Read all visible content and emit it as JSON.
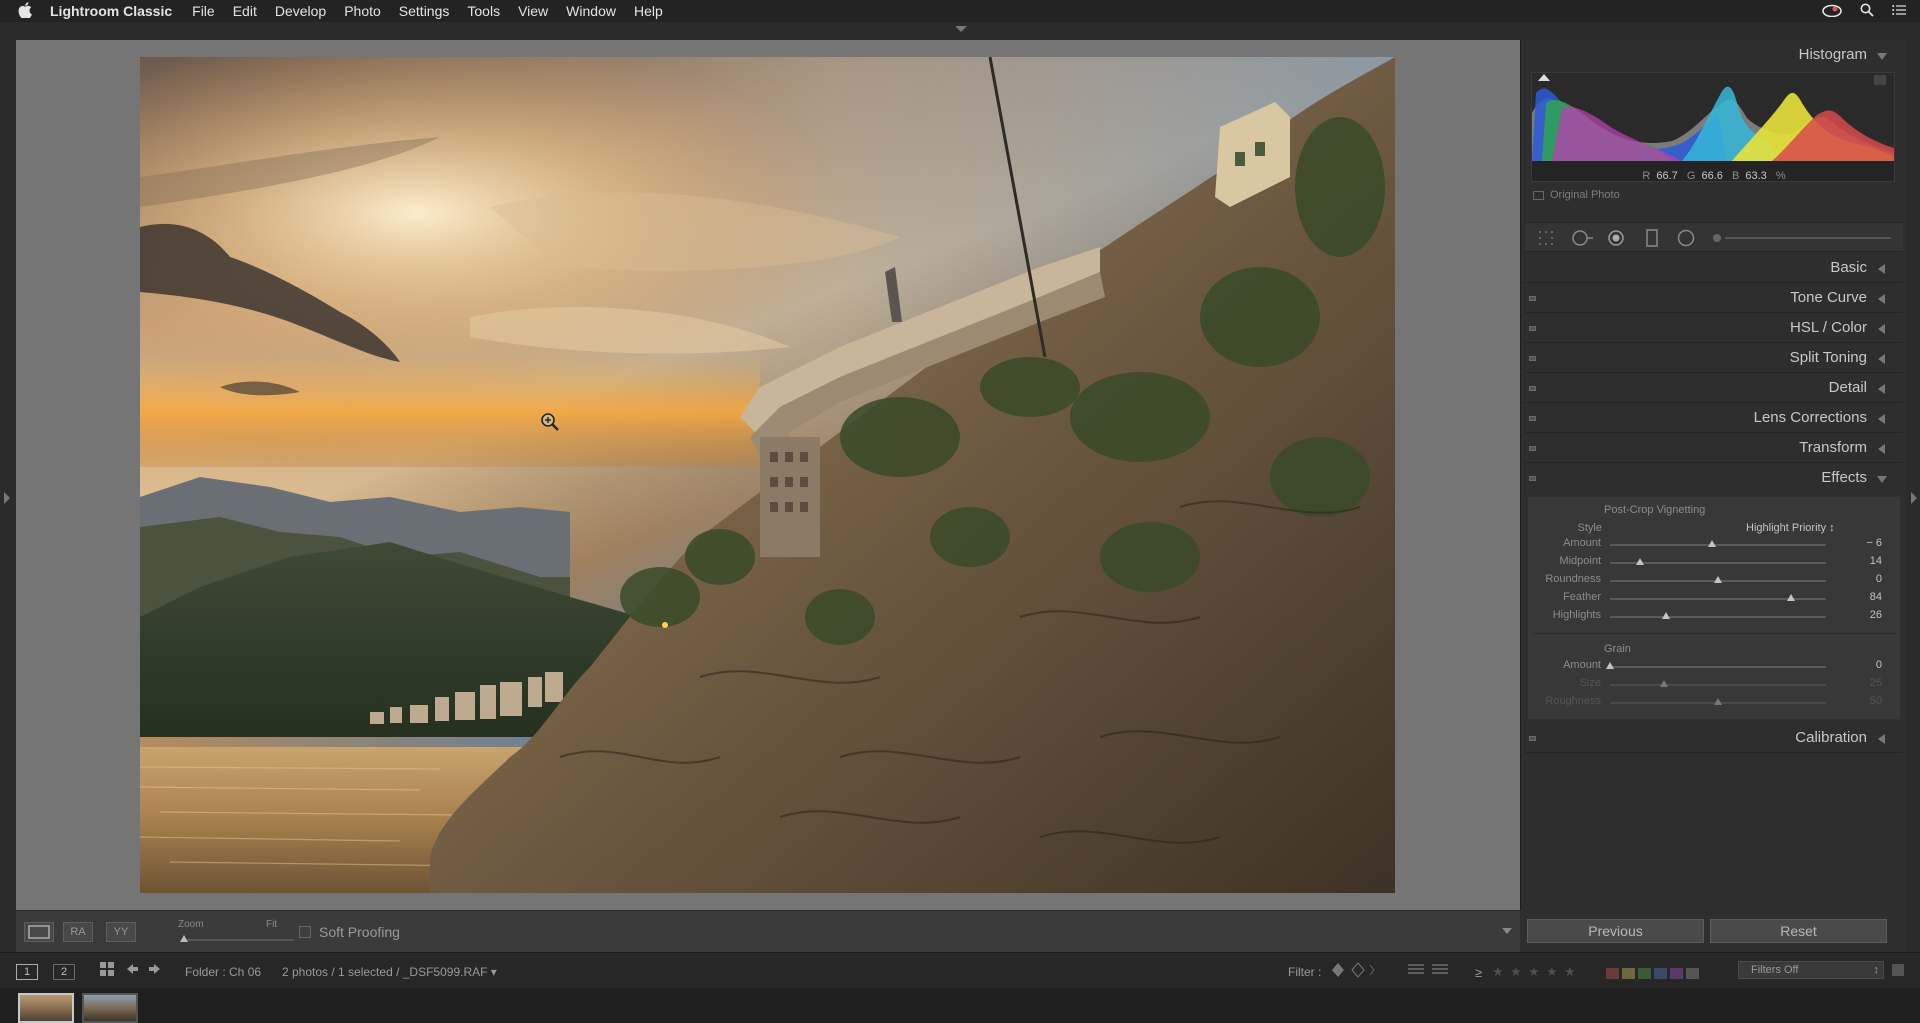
{
  "menubar": {
    "apple": "",
    "app_name": "Lightroom Classic",
    "menus": [
      "File",
      "Edit",
      "Develop",
      "Photo",
      "Settings",
      "Tools",
      "View",
      "Window",
      "Help"
    ]
  },
  "panel": {
    "histogram_title": "Histogram",
    "readout": {
      "r_label": "R",
      "r": "66.7",
      "g_label": "G",
      "g": "66.6",
      "b_label": "B",
      "b": "63.3",
      "unit": "%"
    },
    "original_photo": "Original Photo",
    "sections": {
      "basic": "Basic",
      "tone_curve": "Tone Curve",
      "hsl": "HSL / Color",
      "split_toning": "Split Toning",
      "detail": "Detail",
      "lens_corrections": "Lens Corrections",
      "transform": "Transform",
      "effects": "Effects",
      "calibration": "Calibration"
    },
    "effects": {
      "vignetting_title": "Post-Crop Vignetting",
      "style_label": "Style",
      "style_value": "Highlight Priority",
      "vignette_sliders": [
        {
          "label": "Amount",
          "value": "− 6",
          "level": 0.47
        },
        {
          "label": "Midpoint",
          "value": "14",
          "level": 0.14
        },
        {
          "label": "Roundness",
          "value": "0",
          "level": 0.5
        },
        {
          "label": "Feather",
          "value": "84",
          "level": 0.84
        },
        {
          "label": "Highlights",
          "value": "26",
          "level": 0.26
        }
      ],
      "grain_title": "Grain",
      "grain_sliders": [
        {
          "label": "Amount",
          "value": "0",
          "level": 0.0
        },
        {
          "label": "Size",
          "value": "25",
          "level": 0.25
        },
        {
          "label": "Roughness",
          "value": "50",
          "level": 0.5
        }
      ]
    },
    "previous": "Previous",
    "reset": "Reset"
  },
  "toolbar": {
    "zoom_label": "Zoom",
    "fit_label": "Fit",
    "soft_proofing": "Soft Proofing",
    "compare_icon": "RA",
    "survey_icon": "YY"
  },
  "filterbar": {
    "page1": "1",
    "page2": "2",
    "folder": "Folder : Ch 06",
    "selection": "2 photos / 1 selected / _DSF5099.RAF",
    "filter_label": "Filter :",
    "filters_off": "Filters Off"
  },
  "watermark": "　",
  "colors": {
    "accent": "#c8c8c8",
    "panel": "#2e2e2e",
    "stage": "#757575"
  }
}
